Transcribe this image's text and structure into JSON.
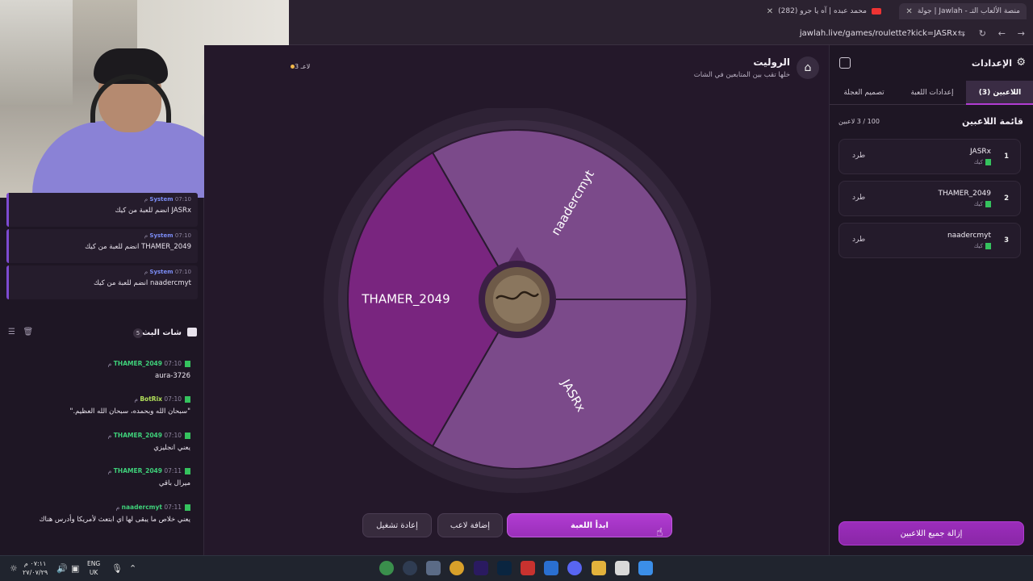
{
  "browser": {
    "tabs": [
      {
        "label": "جولة | Jawlah - منصة الألعاب التـ",
        "active": true
      },
      {
        "label": "(282) محمد عبده | آه يا جرو"
      }
    ],
    "url": "jawlah.live/games/roulette?kick=JASRx"
  },
  "left_panel": {
    "system_messages": [
      {
        "user": "System",
        "time": "07:10 م",
        "text": "JASRx انضم للعبة من كيك"
      },
      {
        "user": "System",
        "time": "07:10 م",
        "text": "THAMER_2049 انضم للعبة من كيك"
      },
      {
        "user": "System",
        "time": "07:10 م",
        "text": "naadercmyt انضم للعبة من كيك"
      }
    ],
    "chat_title": "شات البث",
    "chat_count": "5",
    "chat_messages": [
      {
        "user": "THAMER_2049",
        "time": "07:10 م",
        "text": "aura-3726",
        "color": "#3fd17a"
      },
      {
        "user": "BotRix",
        "time": "07:10 م",
        "text": "\"سبحان الله وبحمده، سبحان الله العظيم.\"",
        "color": "#3fd17a"
      },
      {
        "user": "THAMER_2049",
        "time": "07:10 م",
        "text": "يعني انجليزي",
        "color": "#3fd17a"
      },
      {
        "user": "THAMER_2049",
        "time": "07:11 م",
        "text": "ميرال باقي",
        "color": "#3fd17a"
      },
      {
        "user": "naadercmyt",
        "time": "07:11 م",
        "text": "يعني خلاص ما يبقى لها اي ابتعث لأمريكا وأدرس هناك",
        "color": "#3fd17a"
      }
    ]
  },
  "main": {
    "title": "الروليت",
    "subtitle": "خلها تقب بين المتابعين في الشات",
    "players_pill": "3 لاعـ",
    "wheel": {
      "segments": [
        {
          "label": "naadercmyt",
          "color": "#7b4a8a"
        },
        {
          "label": "JASRx",
          "color": "#7b4a8a"
        },
        {
          "label": "THAMER_2049",
          "color": "#79257f"
        }
      ],
      "rim_color": "#3a2b42"
    },
    "buttons": {
      "reset": "إعادة تشغيل",
      "add_player": "إضافة لاعب",
      "start": "ابدأ اللعبة"
    }
  },
  "settings": {
    "title": "الإعدادات",
    "tabs": [
      "اللاعبين (3)",
      "إعدادات اللعبة",
      "تصميم العجلة"
    ],
    "list_title": "قائمة اللاعبين",
    "list_count": "100 / 3 لاعبين",
    "players": [
      {
        "num": "1",
        "name": "JASRx",
        "source": "كيك",
        "kick": "طرد"
      },
      {
        "num": "2",
        "name": "THAMER_2049",
        "source": "كيك",
        "kick": "طرد"
      },
      {
        "num": "3",
        "name": "naadercmyt",
        "source": "كيك",
        "kick": "طرد"
      }
    ],
    "remove_all": "إزالة جميع اللاعبين"
  },
  "taskbar": {
    "time": "٠٧:١١ م",
    "date": "٢٧/٠٧/٢٩",
    "lang_top": "ENG",
    "lang_bottom": "UK"
  }
}
